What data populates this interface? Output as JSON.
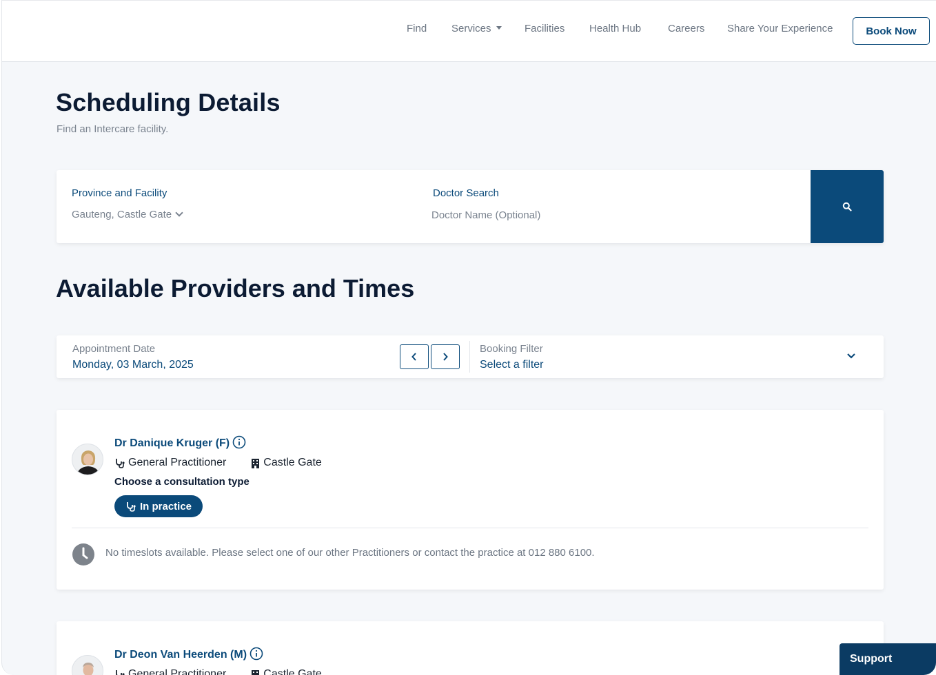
{
  "nav": {
    "items": [
      {
        "label": "Find"
      },
      {
        "label": "Services"
      },
      {
        "label": "Facilities"
      },
      {
        "label": "Health Hub"
      },
      {
        "label": "Careers"
      },
      {
        "label": "Share Your Experience"
      }
    ],
    "book_label": "Book Now"
  },
  "header": {
    "title": "Scheduling Details",
    "subtitle": "Find an Intercare facility."
  },
  "search": {
    "province_label": "Province and Facility",
    "province_value": "Gauteng, Castle Gate",
    "doctor_label": "Doctor Search",
    "doctor_placeholder": "Doctor Name (Optional)"
  },
  "providers_section": {
    "title": "Available Providers and Times",
    "date_label": "Appointment Date",
    "date_value": "Monday, 03 March, 2025",
    "filter_label": "Booking Filter",
    "filter_value": "Select a filter"
  },
  "providers": [
    {
      "name": "Dr Danique Kruger (F)",
      "specialty": "General Practitioner",
      "facility": "Castle Gate",
      "choose_label": "Choose a consultation type",
      "consult_type": "In practice",
      "notice": "No timeslots available. Please select one of our other Practitioners or contact the practice at 012 880 6100."
    },
    {
      "name": "Dr Deon Van Heerden (M)",
      "specialty": "General Practitioner",
      "facility": "Castle Gate"
    }
  ],
  "support_label": "Support",
  "colors": {
    "brand": "#0b4a7a",
    "background": "#f5f7fa",
    "text_muted": "#7a838f"
  }
}
